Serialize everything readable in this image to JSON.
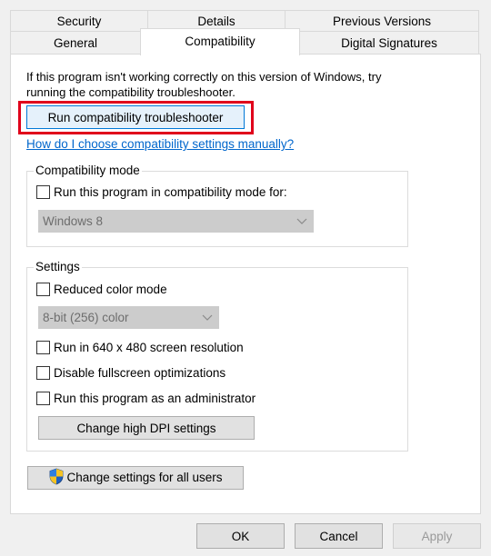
{
  "tabs": {
    "row1": [
      "Security",
      "Details",
      "Previous Versions"
    ],
    "row2": [
      "General",
      "Compatibility",
      "Digital Signatures"
    ],
    "active": "Compatibility"
  },
  "intro_text": "If this program isn't working correctly on this version of Windows, try running the compatibility troubleshooter.",
  "run_troubleshooter_label": "Run compatibility troubleshooter",
  "manual_link": "How do I choose compatibility settings manually?",
  "compat_mode": {
    "legend": "Compatibility mode",
    "checkbox_label": "Run this program in compatibility mode for:",
    "checked": false,
    "select_value": "Windows 8"
  },
  "settings": {
    "legend": "Settings",
    "reduced_color_label": "Reduced color mode",
    "color_select_value": "8-bit (256) color",
    "resolution_label": "Run in 640 x 480 screen resolution",
    "fullscreen_label": "Disable fullscreen optimizations",
    "admin_label": "Run this program as an administrator",
    "dpi_button_label": "Change high DPI settings"
  },
  "all_users_button_label": "Change settings for all users",
  "shield_icon": "uac-shield-icon",
  "footer": {
    "ok": "OK",
    "cancel": "Cancel",
    "apply": "Apply"
  },
  "colors": {
    "highlight_border": "#e0001b",
    "link": "#0066cc",
    "default_button_border": "#0078d7"
  }
}
